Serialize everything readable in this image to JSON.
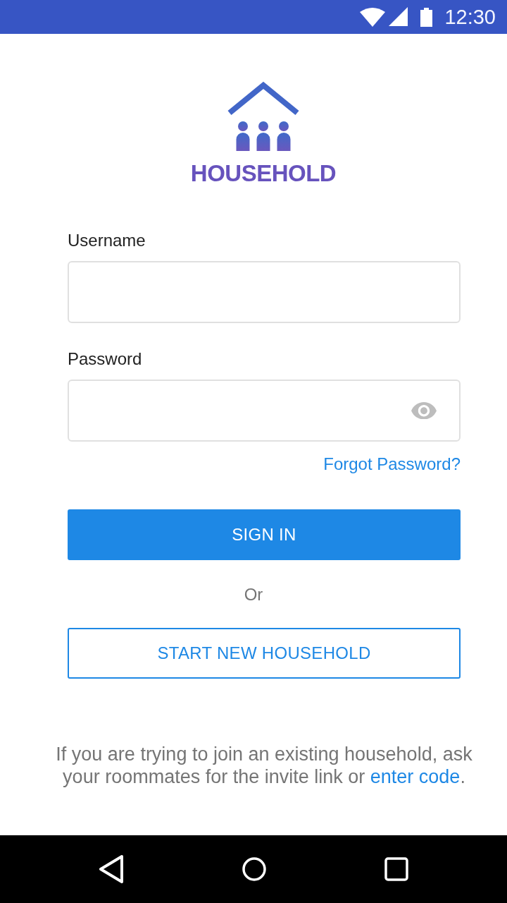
{
  "status_bar": {
    "time": "12:30"
  },
  "logo": {
    "name": "HOUSEHOLD"
  },
  "form": {
    "fields": [
      {
        "label": "Username",
        "kind": "text"
      },
      {
        "label": "Password",
        "kind": "password"
      }
    ],
    "forgot_link": "Forgot Password?",
    "primary_button": "SIGN IN",
    "separator": "Or",
    "secondary_button": "START NEW HOUSEHOLD"
  },
  "footer": {
    "text_before": "If you are trying to join an existing household, ask your roommates for the invite link or ",
    "link": "enter code",
    "text_after": "."
  }
}
